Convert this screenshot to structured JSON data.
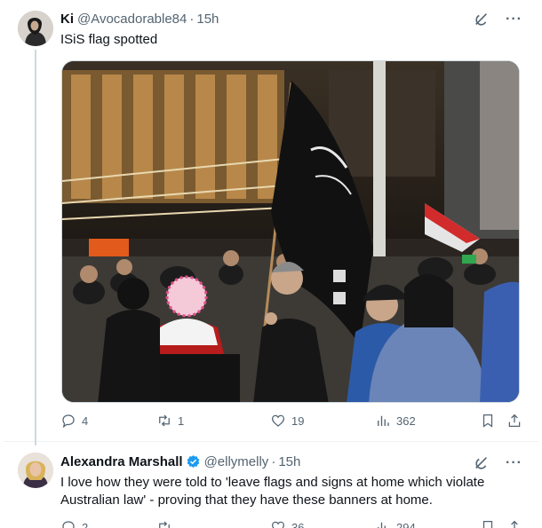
{
  "tweets": [
    {
      "author": {
        "name": "Ki",
        "handle": "@Avocadorable84",
        "time": "15h"
      },
      "text": "ISiS flag spotted",
      "stats": {
        "replies": "4",
        "reposts": "1",
        "likes": "19",
        "views": "362"
      },
      "icons": [
        "grok-icon",
        "more-icon",
        "reply-icon",
        "repost-icon",
        "like-icon",
        "views-icon",
        "bookmark-icon",
        "share-icon"
      ]
    },
    {
      "author": {
        "name": "Alexandra Marshall",
        "handle": "@ellymelly",
        "time": "15h",
        "verified": true
      },
      "text": "I love how they were told to 'leave flags and signs at home which violate Australian law' - proving that they have these banners at home.",
      "stats": {
        "replies": "2",
        "reposts": "",
        "likes": "36",
        "views": "294"
      }
    }
  ],
  "colors": {
    "verified": "#1d9bf0",
    "secondary_text": "#536471",
    "thread_line": "#cfd9de"
  }
}
